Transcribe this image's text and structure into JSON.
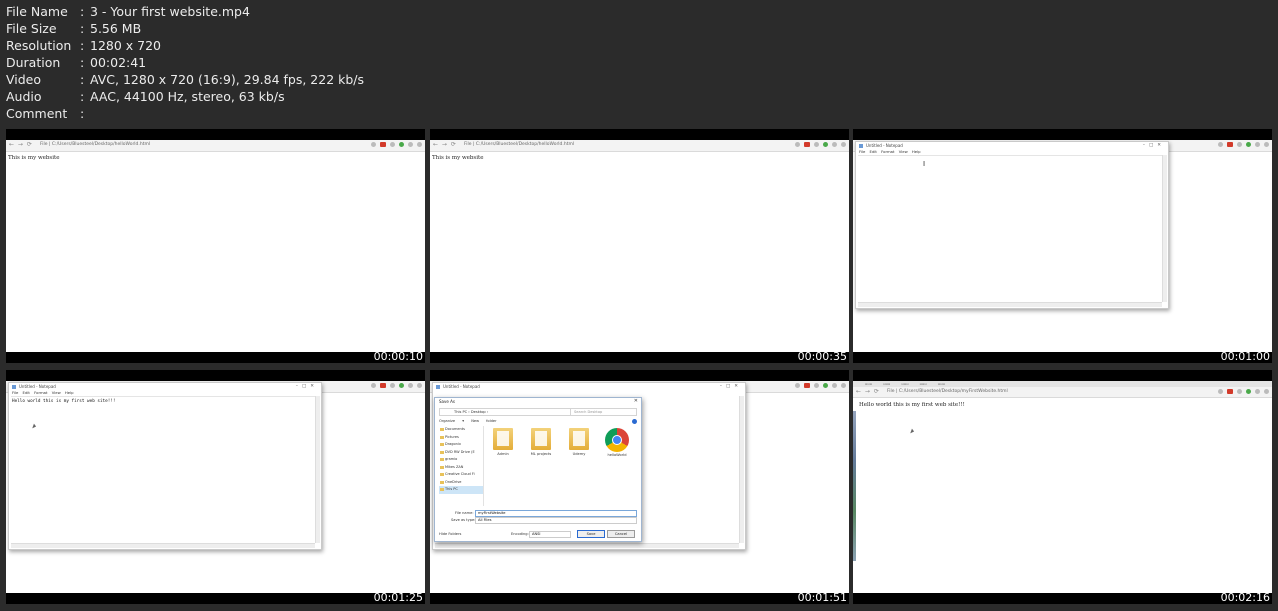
{
  "meta": [
    {
      "key": "File Name",
      "sep": ":",
      "value": "3 - Your first website.mp4"
    },
    {
      "key": "File Size",
      "sep": ":",
      "value": "5.56 MB"
    },
    {
      "key": "Resolution",
      "sep": ":",
      "value": "1280 x 720"
    },
    {
      "key": "Duration",
      "sep": ":",
      "value": "00:02:41"
    },
    {
      "key": "Video",
      "sep": ":",
      "value": "AVC, 1280 x 720 (16:9), 29.84 fps, 222 kb/s"
    },
    {
      "key": "Audio",
      "sep": ":",
      "value": "AAC, 44100 Hz, stereo, 63 kb/s"
    },
    {
      "key": "Comment",
      "sep": ":",
      "value": ""
    }
  ],
  "thumbs": {
    "t1": {
      "time": "00:00:10",
      "url": "File | C:/Users/Bluesteel/Desktop/helloWorld.html",
      "page_text": "This is my website"
    },
    "t2": {
      "time": "00:00:35",
      "url": "File | C:/Users/Bluesteel/Desktop/helloWorld.html",
      "page_text": "This is my website"
    },
    "t3": {
      "time": "00:01:00",
      "notepad_title": "Untitled - Notepad",
      "menu": "File Edit Format View Help"
    },
    "t4": {
      "time": "00:01:25",
      "notepad_title": "Untitled - Notepad",
      "menu": "File Edit Format View Help",
      "text": "Hello world this is my first web site!!!"
    },
    "t5": {
      "time": "00:01:51",
      "notepad_title": "Untitled - Notepad",
      "dialog_title": "Save As",
      "path": "This PC  ›  Desktop  ›",
      "search": "Search Desktop",
      "toolbar": "Organize ▾  New folder",
      "sidebar": [
        "Documents",
        "Pictures",
        "Dragonix",
        "DVD RW Drive (E",
        "gramio",
        "Mikes ZAN",
        "Creative Cloud Fi",
        "OneDrive",
        "This PC"
      ],
      "files": [
        "Admin",
        "ML projects",
        "Udemy",
        "helloWorld"
      ],
      "file_name_label": "File name:",
      "file_name": "myFirstWebsite",
      "save_type_label": "Save as type:",
      "save_type": "All Files",
      "hide_folders": "Hide Folders",
      "encoding_label": "Encoding:",
      "encoding": "ANSI",
      "save": "Save",
      "cancel": "Cancel"
    },
    "t6": {
      "time": "00:02:16",
      "url": "File | C:/Users/Bluesteel/Desktop/myFirstWebsite.html",
      "page_text": "Hello world this is my first web site!!!"
    }
  }
}
